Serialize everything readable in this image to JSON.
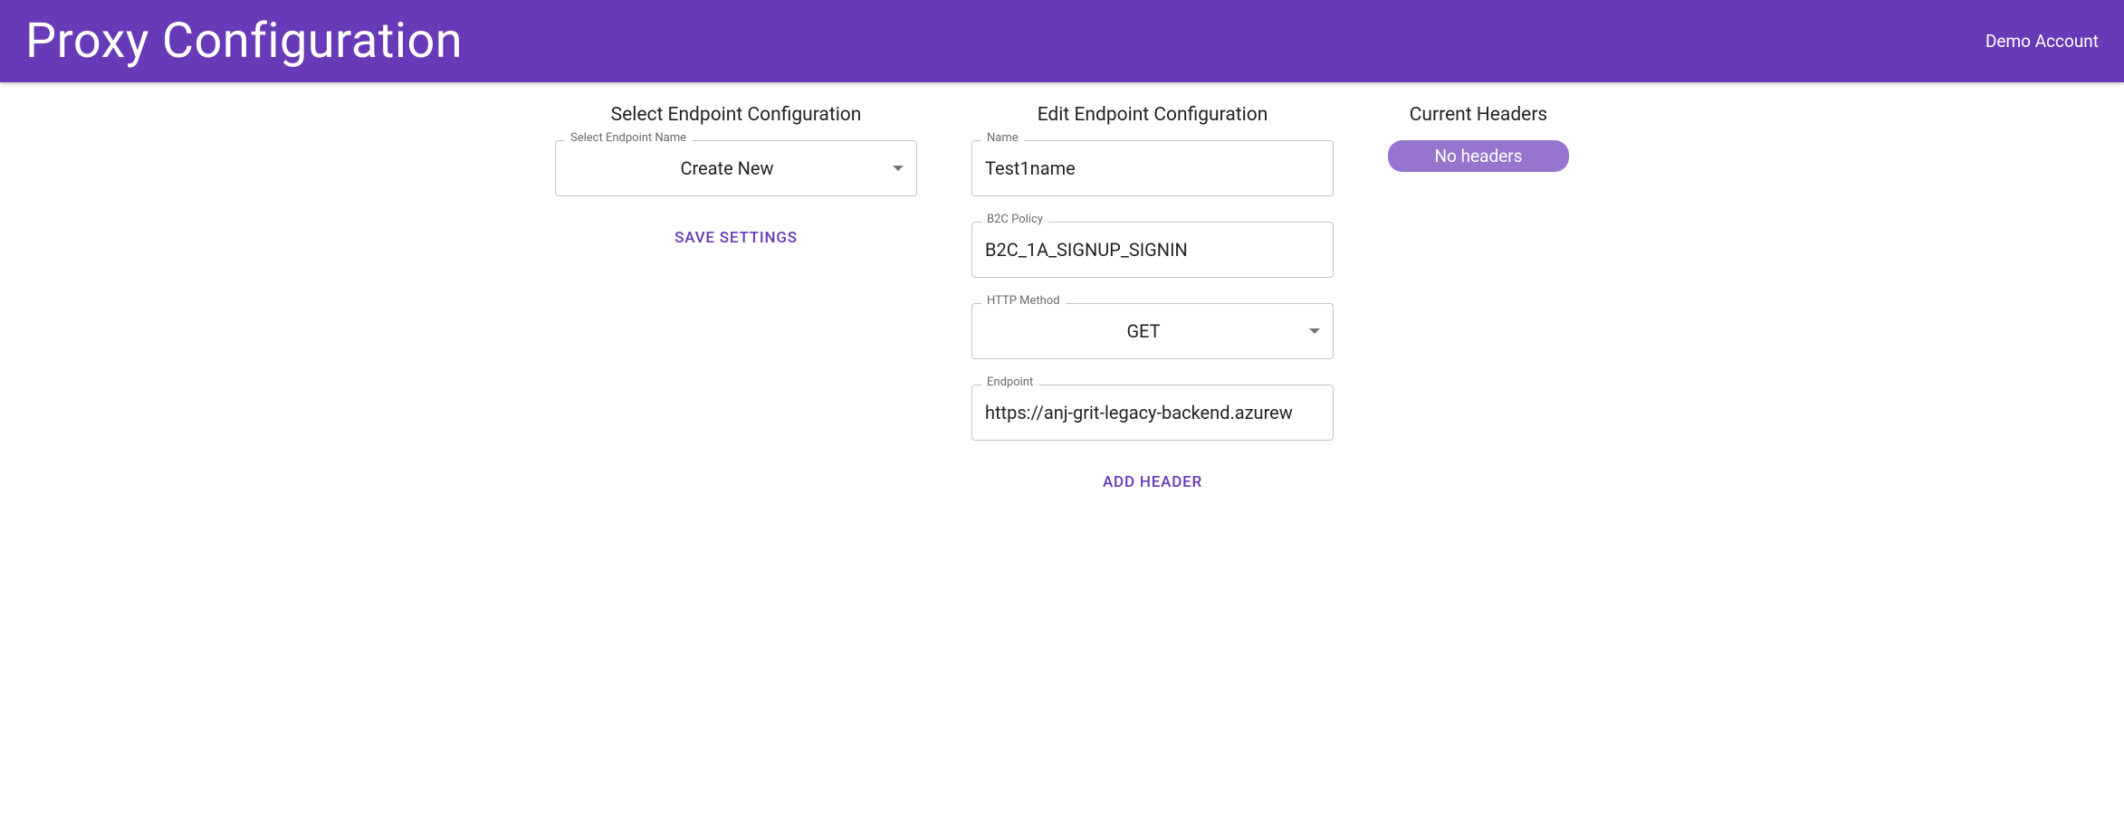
{
  "header": {
    "title": "Proxy Configuration",
    "account_label": "Demo Account"
  },
  "select_section": {
    "title": "Select Endpoint Configuration",
    "field_label": "Select Endpoint Name",
    "selected_value": "Create New",
    "save_button": "SAVE SETTINGS"
  },
  "edit_section": {
    "title": "Edit Endpoint Configuration",
    "name": {
      "label": "Name",
      "value": "Test1name"
    },
    "b2c_policy": {
      "label": "B2C Policy",
      "value": "B2C_1A_SIGNUP_SIGNIN"
    },
    "http_method": {
      "label": "HTTP Method",
      "value": "GET"
    },
    "endpoint": {
      "label": "Endpoint",
      "value": "https://anj-grit-legacy-backend.azurew"
    },
    "add_header_button": "ADD HEADER"
  },
  "headers_section": {
    "title": "Current Headers",
    "empty_label": "No headers"
  }
}
